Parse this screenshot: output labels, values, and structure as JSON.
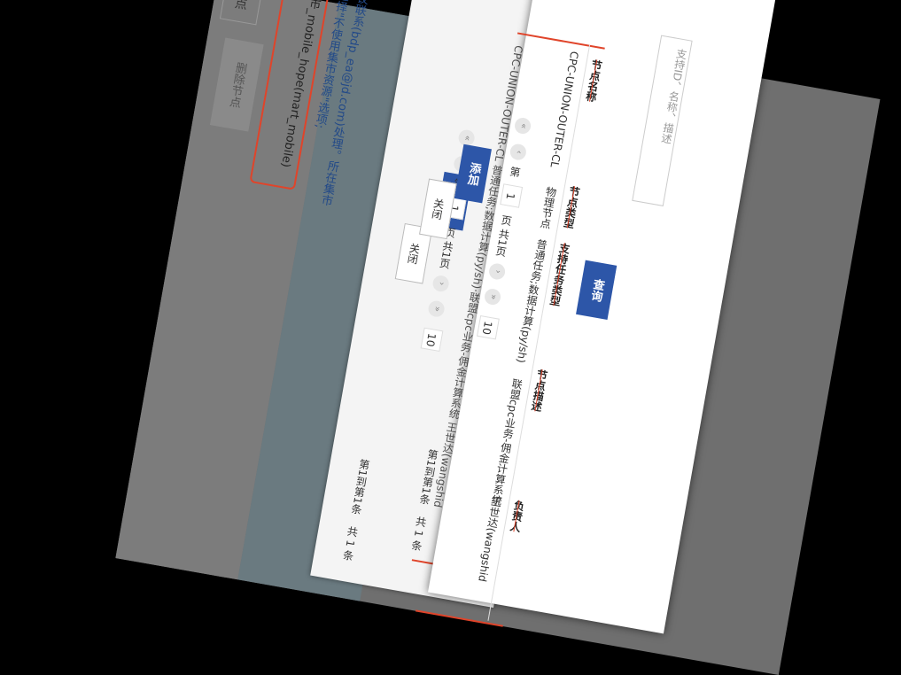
{
  "background": {
    "button_fragment": "点",
    "delete_button": "删除节点",
    "mart_text": "市_mobile_hope(mart_mobile)",
    "notice_text": "建议联系(bdp_ea@jd.com)处理。所在集市请选择\"不使用集市资源\"选项;"
  },
  "dialog_back": {
    "add_button": "添加",
    "close_button": "关闭",
    "pager": {
      "page_prefix": "第",
      "page": "1",
      "page_suffix": "页",
      "total_pages": "共1页",
      "page_size": "10",
      "range": "第1到第1条",
      "total": "共 1 条"
    },
    "cell_text": "CPC-UNION-OUTER-CL 普通任务;数据计算(py/sh)·联盟cpc业务-佣金计算系统 王世达(wangshid"
  },
  "dialog_front": {
    "search_placeholder": "支持ID、名称、描述",
    "query_button": "查询",
    "add_button": "添加",
    "close_button": "关闭",
    "columns": [
      "节点名称",
      "节点类型",
      "支持任务类型",
      "节点描述",
      "负责人"
    ],
    "row": {
      "name": "CPC-UNION-OUTER-CL",
      "type": "物理节点",
      "task_types": "普通任务;数据计算(py/sh)",
      "description": "联盟cpc业务-佣金计算系统",
      "owner": "王世达(wangshid"
    },
    "pager": {
      "page_prefix": "第",
      "page": "1",
      "page_suffix": "页",
      "total_pages": "共1页",
      "page_size": "10",
      "range": "第1到第1条",
      "total": "共 1 条"
    }
  },
  "colors": {
    "primary": "#2d56a8",
    "highlight": "#e0442a",
    "green": "#2aa84a"
  }
}
